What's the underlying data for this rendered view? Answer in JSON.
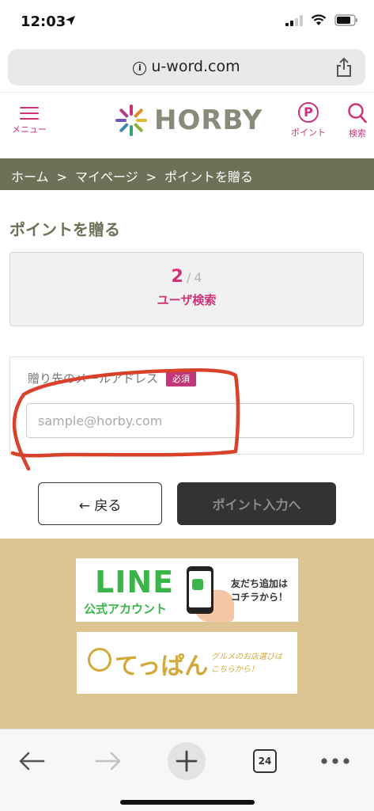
{
  "status_bar": {
    "time": "12:03"
  },
  "browser": {
    "url": "u-word.com",
    "tab_count": "24"
  },
  "header": {
    "menu_label": "メニュー",
    "logo_text": "HORBY",
    "point_symbol": "P",
    "point_label": "ポイント",
    "search_label": "検索"
  },
  "breadcrumb": {
    "items": [
      "ホーム",
      "マイページ",
      "ポイントを贈る"
    ],
    "separator": ">"
  },
  "page": {
    "title": "ポイントを贈る"
  },
  "step": {
    "current": "2",
    "slash": "/",
    "total": "4",
    "label": "ユーザ検索"
  },
  "form": {
    "email_label": "贈り先のメールアドレス",
    "required_badge": "必須",
    "email_placeholder": "sample@horby.com",
    "email_value": ""
  },
  "buttons": {
    "back_label": "← 戻る",
    "next_label": "ポイント入力へ"
  },
  "banners": {
    "line": {
      "title": "LINE",
      "subtitle": "公式アカウント",
      "cta_line1": "友だち追加は",
      "cta_line2": "コチラから！"
    },
    "teppan": {
      "title": "てっぱん",
      "cta_line1": "グルメのお店選びは",
      "cta_line2": "こちらから！"
    }
  },
  "colors": {
    "accent": "#d0327a",
    "olive": "#6c7257",
    "banner_bg": "#dcc592",
    "line_green": "#3ab54a",
    "annotation": "#d9412a"
  }
}
